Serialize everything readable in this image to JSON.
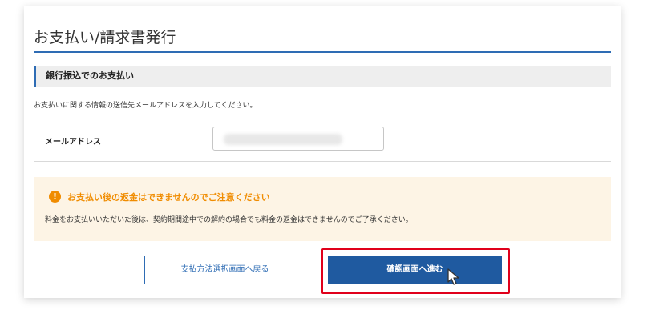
{
  "page": {
    "title": "お支払い/請求書発行"
  },
  "section": {
    "header": "銀行振込でのお支払い"
  },
  "instruction": "お支払いに関する情報の送信先メールアドレスを入力してください。",
  "email": {
    "label": "メールアドレス",
    "value": "",
    "placeholder": ""
  },
  "notice": {
    "icon": "warning-icon",
    "title": "お支払い後の返金はできませんのでご注意ください",
    "body": "料金をお支払いいただいた後は、契約期間途中での解約の場合でも料金の返金はできませんのでご了承ください。"
  },
  "buttons": {
    "back_label": "支払方法選択画面へ戻る",
    "confirm_label": "確認画面へ進む"
  },
  "colors": {
    "accent": "#2e6cb4",
    "primary_button": "#1f5aa0",
    "warning": "#f08c00",
    "notice_bg": "#fdf4e5",
    "highlight": "#e0001b"
  }
}
